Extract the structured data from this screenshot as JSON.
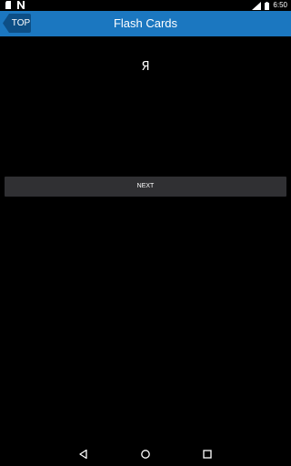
{
  "status_bar": {
    "time": "6:50",
    "icons": [
      "sd-card-icon",
      "n-notification-icon",
      "signal-icon",
      "battery-icon"
    ]
  },
  "app_bar": {
    "back_label": "TOP",
    "title": "Flash Cards",
    "color": "#1b77c0"
  },
  "card": {
    "text": "Я"
  },
  "actions": {
    "next_label": "NEXT"
  },
  "nav": {
    "icons": [
      "back-icon",
      "home-icon",
      "recents-icon"
    ]
  }
}
